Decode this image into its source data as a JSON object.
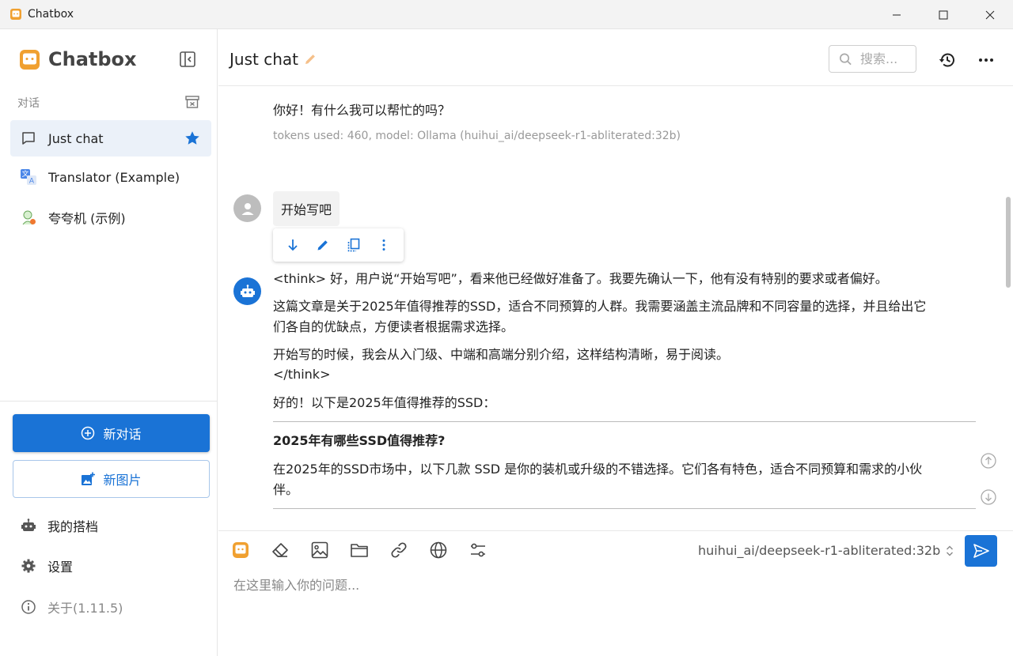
{
  "window": {
    "title": "Chatbox",
    "controls": [
      "minimize-icon",
      "maximize-icon",
      "close-icon"
    ]
  },
  "sidebar": {
    "brand": "Chatbox",
    "section_label": "对话",
    "sessions": [
      {
        "label": "Just chat",
        "icon": "chat-bubble-icon",
        "active": true,
        "starred": true
      },
      {
        "label": "Translator (Example)",
        "icon": "translate-icon",
        "active": false
      },
      {
        "label": "夸夸机 (示例)",
        "icon": "avatar-icon",
        "active": false
      }
    ],
    "new_chat_label": "新对话",
    "new_image_label": "新图片",
    "menu": {
      "my_copilots": "我的搭档",
      "settings": "设置",
      "about": "关于(1.11.5)"
    }
  },
  "header": {
    "title": "Just chat",
    "search_placeholder": "搜索..."
  },
  "messages": {
    "prev_reply": "你好！有什么我可以帮忙的吗？",
    "prev_meta": "tokens used: 460, model: Ollama (huihui_ai/deepseek-r1-abliterated:32b)",
    "user_message": "开始写吧",
    "assistant": {
      "p1": "<think> 好，用户说“开始写吧”，看来他已经做好准备了。我要先确认一下，他有没有特别的要求或者偏好。",
      "p2_line1": "这篇文章是关于2025年值得推荐的SSD，适合不同预算的人群。我需要涵盖主流品牌和不同容量的选择，并且给出它",
      "p2_line2": "们各自的优缺点，方便读者根据需求选择。",
      "p3": "开始写的时候，我会从入门级、中端和高端分别介绍，这样结构清晰，易于阅读。",
      "p3_end": "</think>",
      "p4": "好的！以下是2025年值得推荐的SSD：",
      "heading": "2025年有哪些SSD值得推荐?",
      "p5_line1": "在2025年的SSD市场中，以下几款 SSD 是你的装机或升级的不错选择。它们各有特色，适合不同预算和需求的小伙",
      "p5_line2": "伴。"
    }
  },
  "input": {
    "model": "huihui_ai/deepseek-r1-abliterated:32b",
    "placeholder": "在这里输入你的问题..."
  },
  "colors": {
    "accent": "#1a73d6",
    "active_session_bg": "#ebf1f9",
    "muted_text": "#999999"
  }
}
